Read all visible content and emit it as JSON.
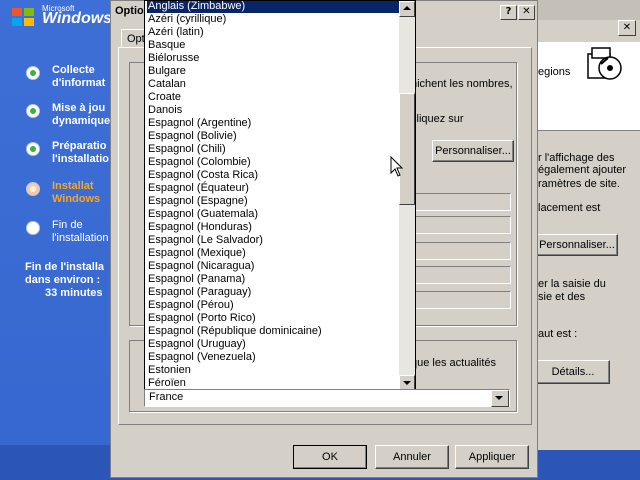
{
  "setup": {
    "logo_small": "Microsoft",
    "logo_text": "Windows",
    "steps": [
      {
        "line1": "Collecte",
        "line2": "d'informat",
        "state": "done"
      },
      {
        "line1": "Mise à jou",
        "line2": "dynamique",
        "state": "done"
      },
      {
        "line1": "Préparatio",
        "line2": "l'installatio",
        "state": "done"
      },
      {
        "line1": "Installat",
        "line2": "Windows",
        "state": "current"
      },
      {
        "line1": "Fin de",
        "line2": "l'installation",
        "state": "pending"
      }
    ],
    "remaining": {
      "line1": "Fin de l'installa",
      "line2": "dans environ :",
      "line3": "33 minutes"
    }
  },
  "back_window": {
    "close_label": "✕",
    "text_regions": "egions",
    "text_affichage1": "r l'affichage des",
    "text_affichage2": "également ajouter",
    "text_affichage3": "ramètres de site.",
    "text_emplacement": "lacement est",
    "personnaliser_label": "Personnaliser...",
    "text_saisie1": "er la saisie du",
    "text_saisie2": "sie et des",
    "text_defaut": "aut est :",
    "details_label": "Détails..."
  },
  "dialog": {
    "title": "Optio",
    "help_btn": "?",
    "close_btn": "✕",
    "tab_label": "Opt",
    "text_nombres": "hichent les nombres,",
    "text_cliquez": "cliquez sur",
    "personnaliser_label": "Personnaliser...",
    "text_actualites": "que les actualités",
    "ok_label": "OK",
    "cancel_label": "Annuler",
    "apply_label": "Appliquer"
  },
  "dropdown": {
    "items": [
      "Anglais (Zimbabwe)",
      "Azéri (cyrillique)",
      "Azéri (latin)",
      "Basque",
      "Biélorusse",
      "Bulgare",
      "Catalan",
      "Croate",
      "Danois",
      "Espagnol (Argentine)",
      "Espagnol (Bolivie)",
      "Espagnol (Chili)",
      "Espagnol (Colombie)",
      "Espagnol (Costa Rica)",
      "Espagnol (Équateur)",
      "Espagnol (Espagne)",
      "Espagnol (Guatemala)",
      "Espagnol (Honduras)",
      "Espagnol (Le Salvador)",
      "Espagnol (Mexique)",
      "Espagnol (Nicaragua)",
      "Espagnol (Panama)",
      "Espagnol (Paraguay)",
      "Espagnol (Pérou)",
      "Espagnol (Porto Rico)",
      "Espagnol (République dominicaine)",
      "Espagnol (Uruguay)",
      "Espagnol (Venezuela)",
      "Estonien",
      "Féroïen"
    ],
    "selected_index": 0,
    "combo_value": "France"
  },
  "colors": {
    "selection": "#0a246a",
    "desktop_blue": "#3a6fd8",
    "dialog_face": "#d4d0c8"
  }
}
